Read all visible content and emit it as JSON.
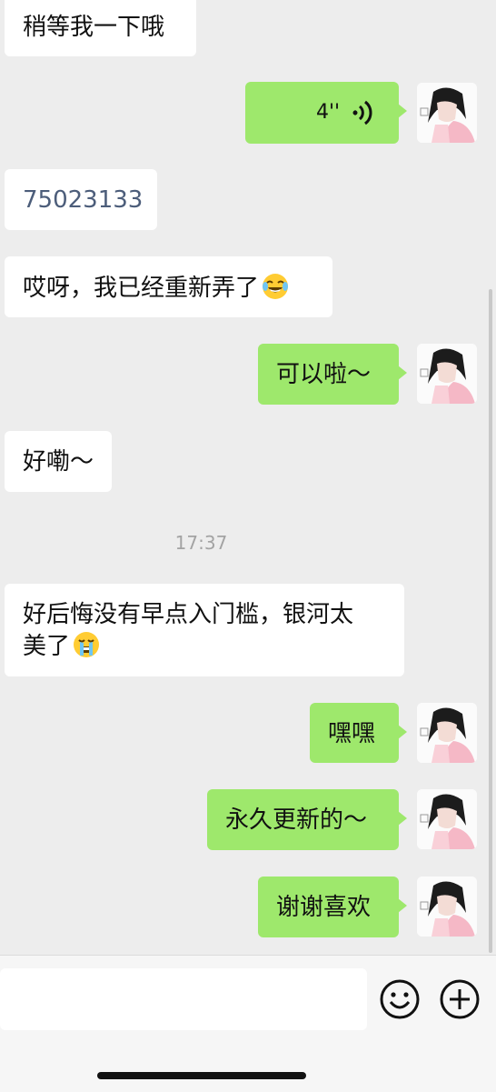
{
  "messages": [
    {
      "side": "in",
      "text": "稍等我一下哦"
    },
    {
      "side": "out",
      "type": "voice",
      "duration": "4''"
    },
    {
      "side": "in",
      "text": "75023133"
    },
    {
      "side": "in",
      "text": "哎呀，我已经重新弄了",
      "emoji": "tears-of-joy"
    },
    {
      "side": "out",
      "text": "可以啦～"
    },
    {
      "side": "in",
      "text": "好嘞～"
    },
    {
      "type": "time",
      "text": "17:37"
    },
    {
      "side": "in",
      "line1": "好后悔没有早点入门槛，银河太",
      "line2": "美了",
      "emoji": "crying"
    },
    {
      "side": "out",
      "text": "嘿嘿"
    },
    {
      "side": "out",
      "text": "永久更新的～"
    },
    {
      "side": "out",
      "text": "谢谢喜欢"
    }
  ],
  "input_bar": {
    "message_input_value": "",
    "emoji_button_icon": "smiley-icon",
    "more_button_icon": "plus-circle-icon"
  },
  "colors": {
    "outgoing_bubble": "#9ee86c",
    "incoming_bubble": "#ffffff",
    "background": "#ededed"
  }
}
